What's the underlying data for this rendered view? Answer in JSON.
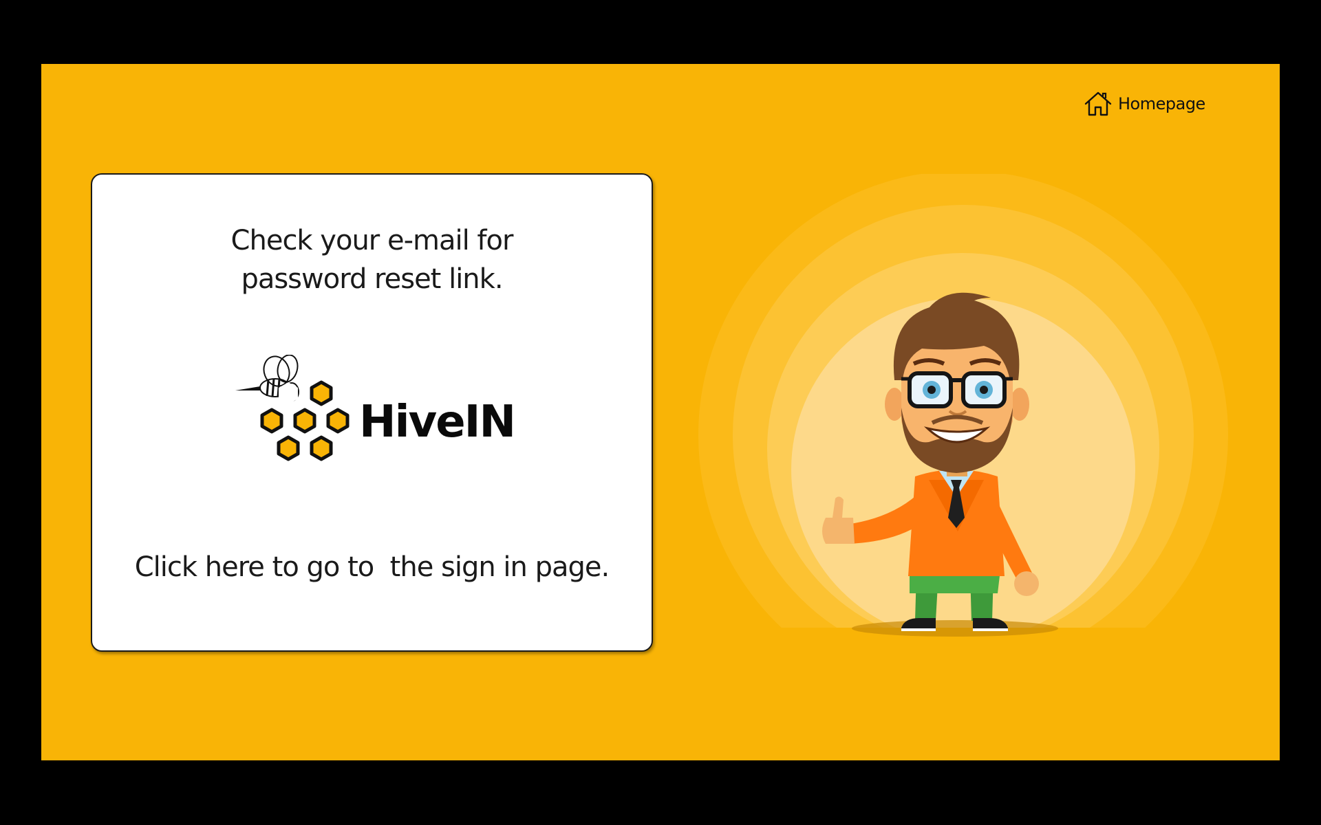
{
  "colors": {
    "background": "#000000",
    "slide": "#F9B406",
    "card": "#FFFFFF",
    "accent": "#F9B406"
  },
  "header": {
    "home_icon": "home-icon",
    "home_label": "Homepage"
  },
  "card": {
    "message_line1": "Check your e-mail for",
    "message_line2": "password reset link.",
    "logo": {
      "brand_name": "HiveIN",
      "icon": "bee-honeycomb-logo"
    },
    "signin_link": "Click here to go to  the sign in page."
  },
  "illustration": {
    "name": "cartoon-man-thumbs-up"
  }
}
